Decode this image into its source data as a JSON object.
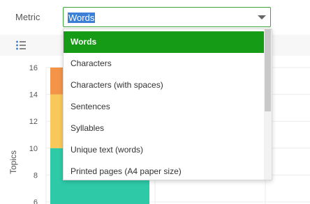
{
  "metric": {
    "label": "Metric",
    "selected": "Words"
  },
  "dropdown": {
    "options": [
      "Words",
      "Characters",
      "Characters (with spaces)",
      "Sentences",
      "Syllables",
      "Unique text (words)",
      "Printed pages (A4 paper size)"
    ],
    "selected_index": 0
  },
  "chart_data": {
    "type": "bar",
    "ylabel": "Topics",
    "y_ticks": [
      16,
      14,
      12,
      10,
      8,
      6
    ],
    "series": [
      {
        "name": "",
        "color": "#2ecaa8",
        "values": [
          10
        ]
      },
      {
        "name": "",
        "color": "#f9c85b",
        "values": [
          4
        ]
      },
      {
        "name": "",
        "color": "#f39449",
        "values": [
          2
        ]
      }
    ],
    "ylim": [
      6,
      16
    ]
  },
  "colors": {
    "accent": "#169b16",
    "highlight": "#3b7fd6"
  },
  "icons": {
    "toolbar": "list-icon",
    "caret": "chevron-down-icon"
  }
}
